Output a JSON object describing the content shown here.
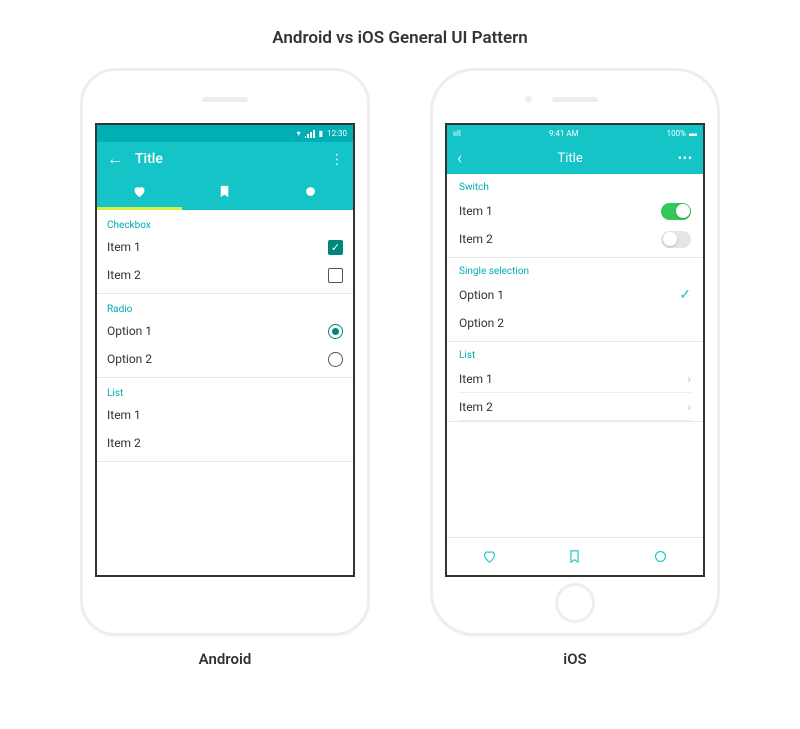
{
  "pageTitle": "Android vs iOS General UI Pattern",
  "android": {
    "caption": "Android",
    "status": {
      "time": "12:30"
    },
    "header": {
      "title": "Title"
    },
    "sections": {
      "checkbox": {
        "header": "Checkbox",
        "items": [
          {
            "label": "Item 1",
            "checked": true
          },
          {
            "label": "Item 2",
            "checked": false
          }
        ]
      },
      "radio": {
        "header": "Radio",
        "items": [
          {
            "label": "Option 1",
            "checked": true
          },
          {
            "label": "Option 2",
            "checked": false
          }
        ]
      },
      "list": {
        "header": "List",
        "items": [
          {
            "label": "Item 1"
          },
          {
            "label": "Item 2"
          }
        ]
      }
    }
  },
  "ios": {
    "caption": "iOS",
    "status": {
      "time": "9:41 AM",
      "battery": "100%",
      "carrier": "ııll"
    },
    "header": {
      "title": "Title"
    },
    "sections": {
      "switch": {
        "header": "Switch",
        "items": [
          {
            "label": "Item 1",
            "on": true
          },
          {
            "label": "Item 2",
            "on": false
          }
        ]
      },
      "single": {
        "header": "Single selection",
        "items": [
          {
            "label": "Option 1",
            "selected": true
          },
          {
            "label": "Option 2",
            "selected": false
          }
        ]
      },
      "list": {
        "header": "List",
        "items": [
          {
            "label": "Item 1"
          },
          {
            "label": "Item 2"
          }
        ]
      }
    }
  }
}
